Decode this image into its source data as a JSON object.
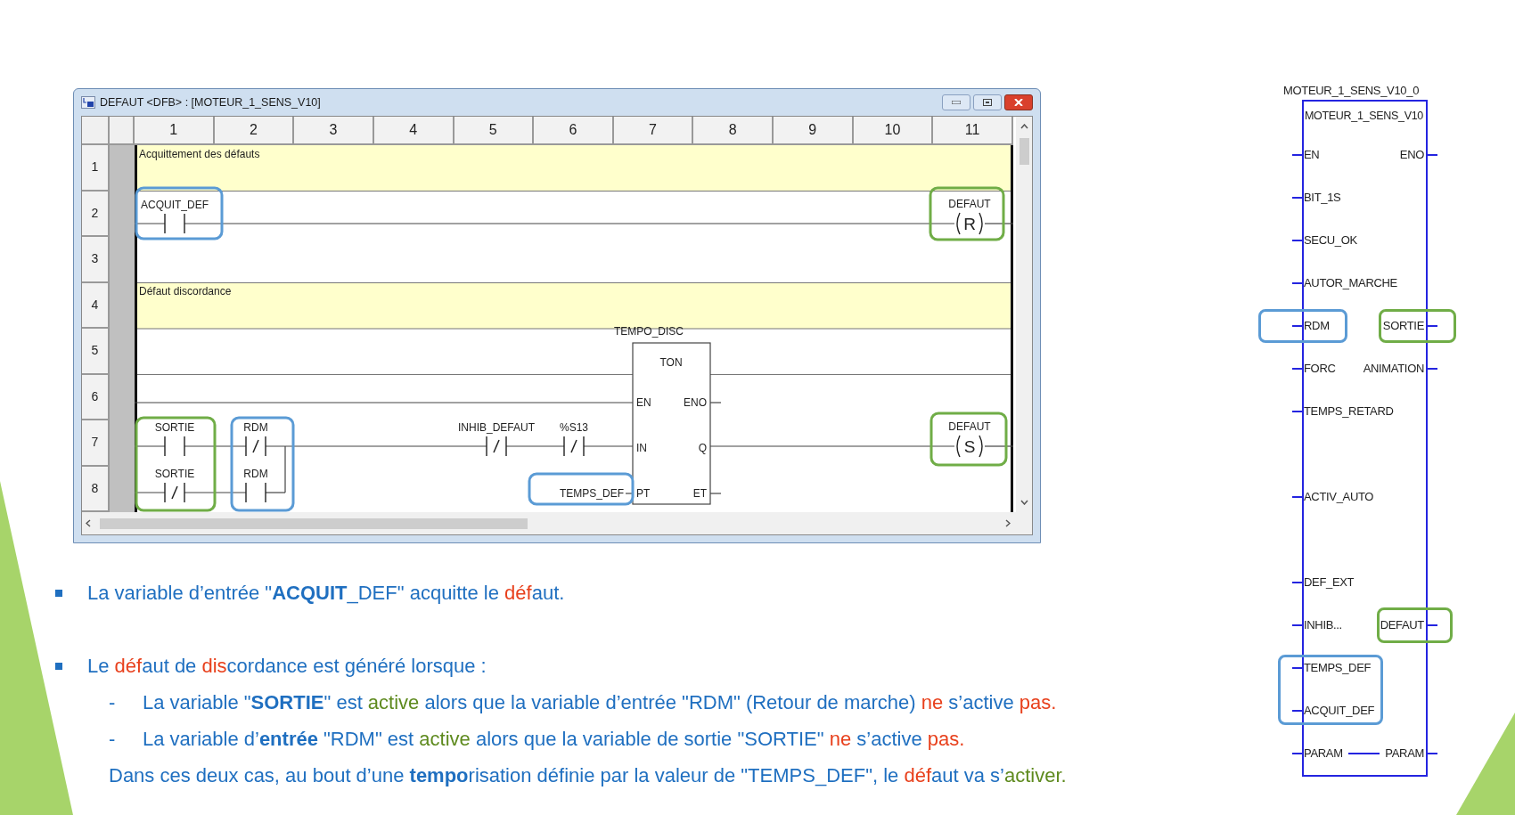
{
  "window": {
    "title": "DEFAUT <DFB> : [MOTEUR_1_SENS_V10]"
  },
  "ladder": {
    "columns": [
      "1",
      "2",
      "3",
      "4",
      "5",
      "6",
      "7",
      "8",
      "9",
      "10",
      "11"
    ],
    "rows": [
      "1",
      "2",
      "3",
      "4",
      "5",
      "6",
      "7",
      "8"
    ],
    "comments": [
      "Acquittement des défauts",
      "Défaut discordance"
    ],
    "contacts": [
      {
        "label": "ACQUIT_DEF",
        "kind": "normal"
      },
      {
        "label": "SORTIE",
        "kind": "normal"
      },
      {
        "label": "SORTIE",
        "kind": "negated"
      },
      {
        "label": "RDM",
        "kind": "negated"
      },
      {
        "label": "RDM",
        "kind": "normal"
      },
      {
        "label": "INHIB_DEFAUT",
        "kind": "negated"
      },
      {
        "label": "%S13",
        "kind": "negated"
      }
    ],
    "coils": [
      {
        "label": "DEFAUT",
        "letter": "R"
      },
      {
        "label": "DEFAUT",
        "letter": "S"
      }
    ],
    "timer": {
      "instance": "TEMPO_DISC",
      "type": "TON",
      "inputs": [
        "EN",
        "IN",
        "PT"
      ],
      "outputs": [
        "ENO",
        "Q",
        "ET"
      ],
      "preset": "TEMPS_DEF"
    }
  },
  "function_block": {
    "instance": "MOTEUR_1_SENS_V10_0",
    "type": "MOTEUR_1_SENS_V10",
    "pins": [
      {
        "kind": "pair",
        "input": "EN",
        "output": "ENO"
      },
      {
        "kind": "input",
        "input": "BIT_1S"
      },
      {
        "kind": "input",
        "input": "SECU_OK"
      },
      {
        "kind": "input",
        "input": "AUTOR_MARCHE"
      },
      {
        "kind": "pair",
        "input": "RDM",
        "output": "SORTIE"
      },
      {
        "kind": "pair",
        "input": "FORC",
        "output": "ANIMATION"
      },
      {
        "kind": "input",
        "input": "TEMPS_RETARD"
      },
      {
        "kind": "input",
        "input": "ACTIV_AUTO"
      },
      {
        "kind": "input",
        "input": "DEF_EXT"
      },
      {
        "kind": "pair",
        "input": "INHIB...",
        "output": "DEFAUT"
      },
      {
        "kind": "input",
        "input": "TEMPS_DEF"
      },
      {
        "kind": "input",
        "input": "ACQUIT_DEF"
      },
      {
        "kind": "inout",
        "input": "PARAM",
        "output": "PARAM"
      }
    ]
  },
  "notes": [
    {
      "kind": "bullet",
      "segments": [
        {
          "text": "La variable d’entrée \"**ACQUIT**_DEF\" acquitte le ",
          "color": "#1f6fc0"
        },
        {
          "text": "déf",
          "color": "#e8401c"
        },
        {
          "text": "aut.",
          "color": "#1f6fc0"
        }
      ]
    },
    {
      "kind": "bullet",
      "segments": [
        {
          "text": "Le ",
          "color": "#1f6fc0"
        },
        {
          "text": "déf",
          "color": "#e8401c"
        },
        {
          "text": "aut de ",
          "color": "#1f6fc0"
        },
        {
          "text": "dis",
          "color": "#e8401c"
        },
        {
          "text": "cordance est généré lorsque  :",
          "color": "#1f6fc0"
        }
      ]
    },
    {
      "kind": "dash",
      "marker": "-",
      "segments": [
        {
          "text": "La variable \"**SORTIE**\" est ",
          "color": "#1f6fc0"
        },
        {
          "text": "active",
          "color": "#5e8a1e"
        },
        {
          "text": " alors que la variable d’entrée \"RDM\" (Retour de marche) ",
          "color": "#1f6fc0"
        },
        {
          "text": "ne",
          "color": "#e8401c"
        },
        {
          "text": " s’active ",
          "color": "#1f6fc0"
        },
        {
          "text": "pas.",
          "color": "#e8401c"
        }
      ]
    },
    {
      "kind": "dash",
      "marker": "-",
      "segments": [
        {
          "text": "La variable d’**entrée** \"RDM\" est ",
          "color": "#1f6fc0"
        },
        {
          "text": "active",
          "color": "#5e8a1e"
        },
        {
          "text": " alors que la variable de sortie \"SORTIE\" ",
          "color": "#1f6fc0"
        },
        {
          "text": "ne",
          "color": "#e8401c"
        },
        {
          "text": " s’active ",
          "color": "#1f6fc0"
        },
        {
          "text": "pas.",
          "color": "#e8401c"
        }
      ]
    },
    {
      "kind": "plain",
      "segments": [
        {
          "text": "Dans ces deux cas, au bout d’une **tempo**risation définie par la valeur de \"TEMPS_DEF\", le ",
          "color": "#1f6fc0"
        },
        {
          "text": "déf",
          "color": "#e8401c"
        },
        {
          "text": "aut va s’",
          "color": "#1f6fc0"
        },
        {
          "text": "activer.",
          "color": "#5e8a1e"
        }
      ]
    }
  ]
}
